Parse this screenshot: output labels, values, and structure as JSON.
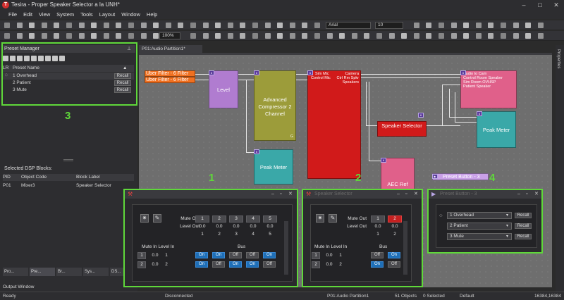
{
  "window": {
    "title": "Tesira - Proper Speaker Selector a la UNH*",
    "logo_letter": "T",
    "minimize": "–",
    "maximize": "□",
    "close": "✕"
  },
  "menu": [
    "File",
    "Edit",
    "View",
    "System",
    "Tools",
    "Layout",
    "Window",
    "Help"
  ],
  "toolbar": {
    "font": "Arial",
    "font_size": "10",
    "zoom": "100%"
  },
  "preset_manager": {
    "title": "Preset Manager",
    "column_header": "Preset Name",
    "lr": "LR",
    "recall_label": "Recall",
    "presets": [
      {
        "name": "1 Overhead"
      },
      {
        "name": "2 Patient"
      },
      {
        "name": "3 Mute"
      }
    ]
  },
  "selected_blocks": {
    "title": "Selected DSP Blocks:",
    "headers": [
      "PID",
      "Object Code",
      "Block Label"
    ],
    "rows": [
      {
        "pid": "P01",
        "code": "Mixer3",
        "label": "Speaker Selector"
      }
    ]
  },
  "bottom_tabs": [
    "Pro...",
    "Pre...",
    "Br...",
    "Sys...",
    "DS..."
  ],
  "output_tab": "Output Window",
  "doc_tab": "P01:Audio Partition1*",
  "right_side_tab": "Properties",
  "canvas": {
    "uber_filter_1": "Uber Filter - 6 Filter",
    "uber_filter_2": "Uber Filter - 6 Filter",
    "level": "Level",
    "compressor": "Advanced Compressor 2 Channel",
    "compressor_tag": "G",
    "peak_meter_1": "Peak Meter",
    "mixer_in_1": "Sim Mic",
    "mixer_in_2": "Control Mic",
    "mixer_out_1": "Camera",
    "mixer_out_2": "Ctrl Rm Spkr",
    "mixer_out_3": "Speakers",
    "speaker_selector": "Speaker Selector",
    "router_out_1": "Audio to Cam",
    "router_out_2": "Control Room Speaker",
    "router_out_3": "Sim Room OVHSP",
    "router_out_4": "Patient Speaker",
    "peak_meter_2": "Peak Meter",
    "aec_ref": "AEC Ref",
    "preset_button": "Preset Button - 3"
  },
  "callouts": [
    "1",
    "2",
    "3",
    "4"
  ],
  "dialog1": {
    "mute_out": "Mute Out",
    "level_out": "Level Out",
    "cols": [
      "1",
      "2",
      "3",
      "4",
      "5"
    ],
    "levels": [
      "0.0",
      "0.0",
      "0.0",
      "0.0",
      "0.0"
    ],
    "idx": [
      "1",
      "2",
      "3",
      "4",
      "5"
    ],
    "row_head": "Mute In Level In",
    "bus": "Bus",
    "rows": [
      {
        "n": "1",
        "lvl": "0.0",
        "k": "1",
        "states": [
          "On",
          "On",
          "Off",
          "Off",
          "On"
        ]
      },
      {
        "n": "2",
        "lvl": "0.0",
        "k": "2",
        "states": [
          "On",
          "Off",
          "On",
          "On",
          "Off"
        ]
      }
    ]
  },
  "dialog2": {
    "title": "Speaker Selector",
    "mute_out": "Mute Out",
    "level_out": "Level Out",
    "cols": [
      "1",
      "2"
    ],
    "levels": [
      "0.0",
      "0.0"
    ],
    "idx": [
      "1",
      "2"
    ],
    "row_head": "Mute In Level In",
    "bus": "Bus",
    "rows": [
      {
        "n": "1",
        "lvl": "0.0",
        "k": "1",
        "states": [
          "Off",
          "On"
        ]
      },
      {
        "n": "2",
        "lvl": "0.0",
        "k": "2",
        "states": [
          "On",
          "Off"
        ]
      }
    ]
  },
  "dialog3": {
    "title": "Preset Button - 3",
    "recall_label": "Recall",
    "items": [
      "1 Overhead",
      "2 Patient",
      "3 Mute"
    ]
  },
  "status": {
    "ready": "Ready",
    "connection": "Disconnected",
    "partition": "P01:Audio Partition1",
    "objects": "51 Objects",
    "selected": "0 Selected",
    "layer": "Default",
    "coords": "16384,16384"
  },
  "colors": {
    "highlight": "#5fd83a",
    "on_button": "#1e6fb8",
    "mixer": "#d11a1a",
    "level": "#b07cd0",
    "compressor": "#9c9c3a",
    "peak_meter": "#3aa8a8",
    "router": "#e0608a",
    "uber_filter": "#f07020"
  }
}
